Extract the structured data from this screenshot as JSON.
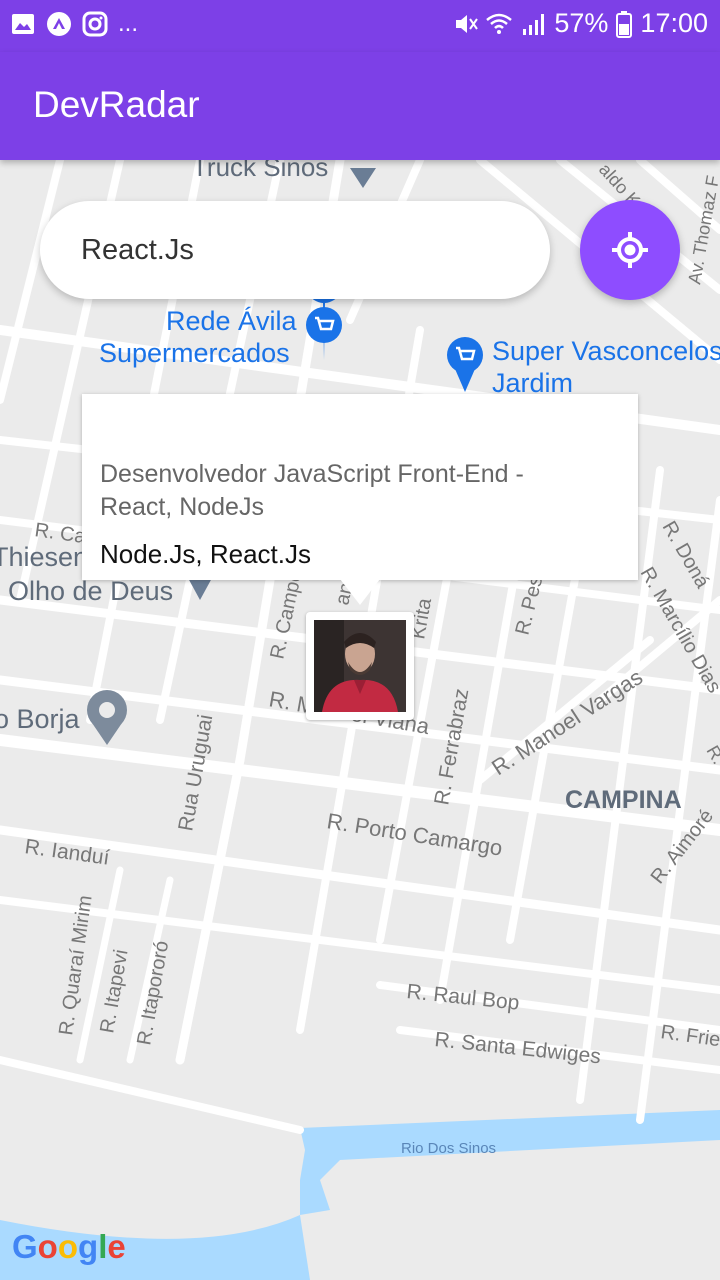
{
  "status": {
    "battery": "57%",
    "time": "17:00",
    "more": "..."
  },
  "app": {
    "title": "DevRadar"
  },
  "search": {
    "value": "React.Js"
  },
  "callout": {
    "name": "",
    "bio": "Desenvolvedor JavaScript Front-End - React, NodeJs",
    "techs": "Node.Js, React.Js"
  },
  "map": {
    "labels": {
      "truck": "Truck Sinos",
      "rede1": "Rede Ávila",
      "rede2": "Supermercados",
      "super1": "Super Vasconcelos",
      "super2": "Jardim",
      "thiesen": "Thiesen",
      "olho": "Olho de Deus",
      "borja": "o Borja",
      "rca": "R. Ca",
      "campo": "R. Campo",
      "rano": "ano",
      "krita": "Krita",
      "rpes": "R. Pes",
      "manoelviana": "R. Manoel Viana",
      "ferrabraz": "R. Ferrabraz",
      "manoelvargas": "R. Manoel Vargas",
      "campina": "CAMPINA",
      "uruguai": "Rua Uruguai",
      "portocamargo": "R. Porto Camargo",
      "ianduí": "R. Ianduí",
      "quarai": "R. Quaraí Mirim",
      "itapevi": "R. Itapevi",
      "itapororo": "R. Itapororó",
      "raulbop": "R. Raul Bop",
      "santaedwiges": "R. Santa Edwiges",
      "rio": "Rio Dos Sinos",
      "rfried": "R. Fried",
      "ronda": "R. Doná",
      "marcilio": "R. Marcílio Dias",
      "raimore": "R. Aimoré",
      "thomaz": "Av. Thomaz F",
      "aldo": "aldo Kolin",
      "rr": "R."
    }
  },
  "google": "Google",
  "colors": {
    "primary": "#7d40e7",
    "button": "#8e4dff",
    "poi": "#1a73e8",
    "water": "#aadaff"
  }
}
